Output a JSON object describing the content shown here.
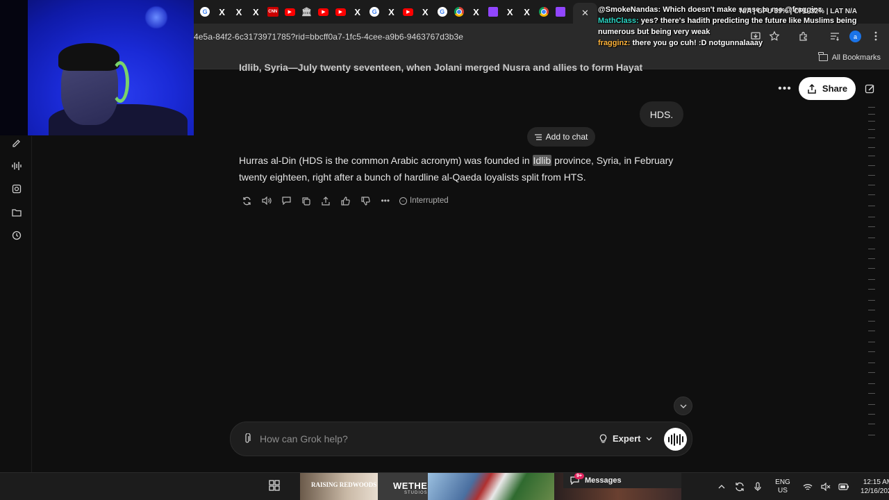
{
  "browser": {
    "url": "4e5a-84f2-6c3173971785?rid=bbcff0a7-1fc5-4cee-a9b6-9463767d3b3e",
    "tabs": [
      {
        "icon": "google-icon",
        "glyph": "G"
      },
      {
        "icon": "x-icon",
        "glyph": "X"
      },
      {
        "icon": "x-icon",
        "glyph": "X"
      },
      {
        "icon": "x-icon",
        "glyph": "X"
      },
      {
        "icon": "cnn-icon",
        "glyph": "CNN"
      },
      {
        "icon": "youtube-icon",
        "glyph": "▶"
      },
      {
        "icon": "bank-icon",
        "glyph": "🏛"
      },
      {
        "icon": "youtube-icon",
        "glyph": "▶"
      },
      {
        "icon": "youtube-icon",
        "glyph": "▶"
      },
      {
        "icon": "x-icon",
        "glyph": "X"
      },
      {
        "icon": "google-icon",
        "glyph": "G"
      },
      {
        "icon": "x-icon",
        "glyph": "X"
      },
      {
        "icon": "youtube-icon",
        "glyph": "▶"
      },
      {
        "icon": "x-icon",
        "glyph": "X"
      },
      {
        "icon": "google-icon",
        "glyph": "G"
      },
      {
        "icon": "chrome-icon",
        "glyph": ""
      },
      {
        "icon": "x-icon",
        "glyph": "X"
      },
      {
        "icon": "twitch-icon",
        "glyph": ""
      },
      {
        "icon": "x-icon",
        "glyph": "X"
      },
      {
        "icon": "x-icon",
        "glyph": "X"
      },
      {
        "icon": "chrome-icon",
        "glyph": ""
      },
      {
        "icon": "twitch-icon",
        "glyph": ""
      }
    ],
    "active_tab_close": "✕",
    "all_bookmarks": "All Bookmarks"
  },
  "stream": {
    "chat": [
      {
        "user": "@SmokeNandas:",
        "msg": "Which doesn't make sense to me @fragginz",
        "color": "#ffffff"
      },
      {
        "user": "MathClass:",
        "msg": "yes? there's hadith predicting the future like Muslims being numerous but being very weak",
        "color": "#2bd6c4"
      },
      {
        "user": "fragginz:",
        "msg": "there you go cuh! :D notgunnalaaay",
        "color": "#ffb43a"
      }
    ],
    "hw_stats": "N/A | GPU 39% | CPU 32% | LAT N/A"
  },
  "conversation": {
    "partial_previous": "Idlib, Syria—July twenty seventeen, when Jolani merged Nusra and allies to form Hayat",
    "user_message": "HDS.",
    "add_to_chat": "Add to chat",
    "response_before": "Hurras al-Din (HDS is the common Arabic acronym) was founded in ",
    "response_highlight": "Idlib",
    "response_after": " province, Syria, in February twenty eighteen, right after a bunch of hardline al-Qaeda loyalists split from HTS.",
    "status": "Interrupted"
  },
  "header": {
    "share_label": "Share"
  },
  "composer": {
    "placeholder": "How can Grok help?",
    "mode": "Expert"
  },
  "sidebar": {
    "avatar_letter": "a"
  },
  "profile": {
    "letter": "a"
  },
  "taskbar": {
    "thumb1_caption": "RAISING REDWOODS",
    "thumb2_title": "WETHE",
    "thumb2_sub": "STUDIOS",
    "messages_label": "Messages",
    "messages_badge": "9+",
    "lang_line1": "ENG",
    "lang_line2": "US",
    "time": "12:15 AM",
    "date": "12/16/2025"
  }
}
